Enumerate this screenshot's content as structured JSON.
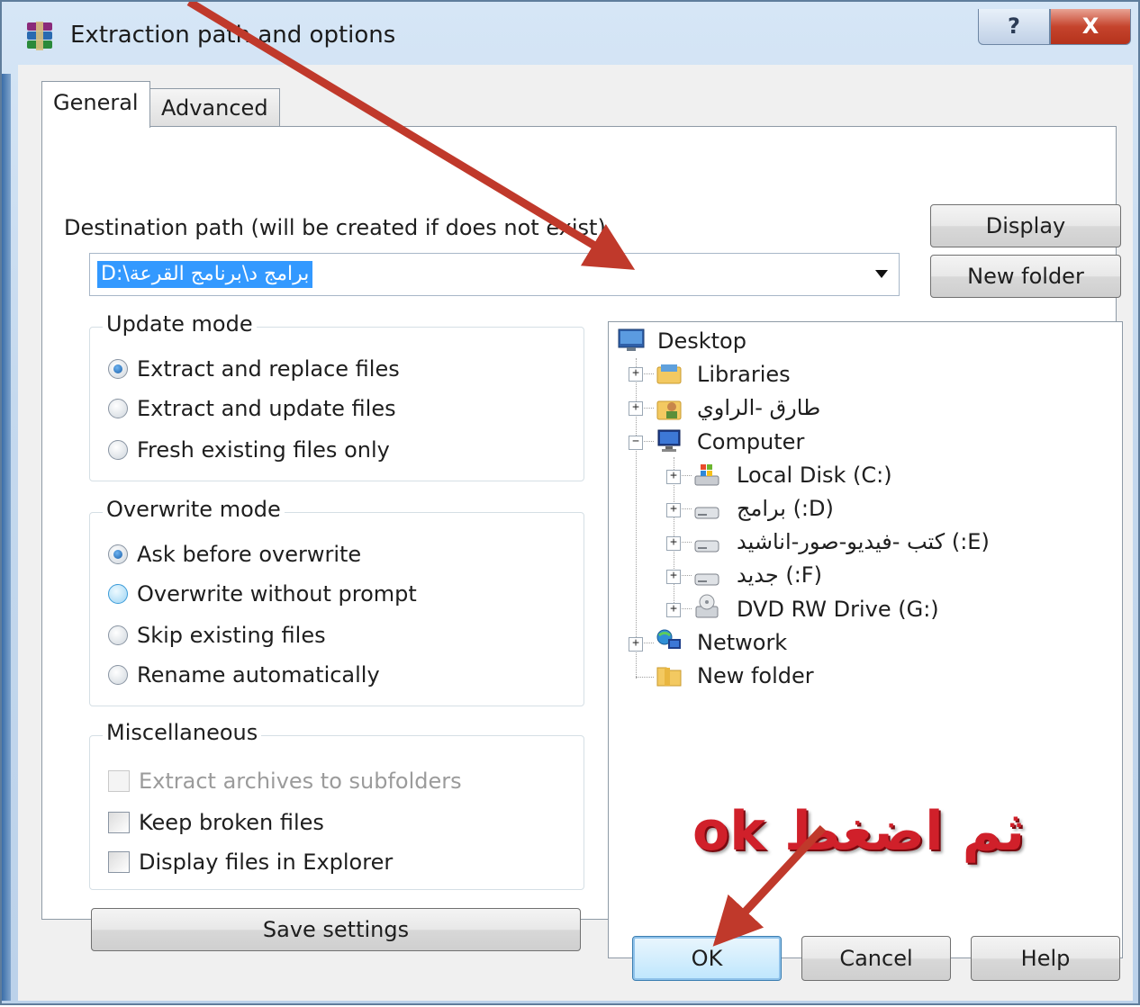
{
  "window": {
    "title": "Extraction path and options",
    "help_glyph": "?",
    "close_glyph": "X"
  },
  "tabs": [
    {
      "label": "General",
      "active": true
    },
    {
      "label": "Advanced",
      "active": false
    }
  ],
  "destination": {
    "label": "Destination path (will be created if does not exist)",
    "value": "D:\\برامج د\\برنامج القرعة"
  },
  "buttons": {
    "display": "Display",
    "new_folder": "New folder",
    "save_settings": "Save settings",
    "ok": "OK",
    "cancel": "Cancel",
    "help": "Help"
  },
  "update_mode": {
    "title": "Update mode",
    "options": [
      {
        "label": "Extract and replace files",
        "selected": true
      },
      {
        "label": "Extract and update files",
        "selected": false
      },
      {
        "label": "Fresh existing files only",
        "selected": false
      }
    ]
  },
  "overwrite_mode": {
    "title": "Overwrite mode",
    "options": [
      {
        "label": "Ask before overwrite",
        "selected": true
      },
      {
        "label": "Overwrite without prompt",
        "selected": false
      },
      {
        "label": "Skip existing files",
        "selected": false
      },
      {
        "label": "Rename automatically",
        "selected": false
      }
    ]
  },
  "miscellaneous": {
    "title": "Miscellaneous",
    "options": [
      {
        "label": "Extract archives to subfolders",
        "checked": false,
        "enabled": false
      },
      {
        "label": "Keep broken files",
        "checked": false,
        "enabled": true
      },
      {
        "label": "Display files in Explorer",
        "checked": false,
        "enabled": true
      }
    ]
  },
  "tree": {
    "nodes": [
      {
        "label": "Desktop",
        "icon": "desktop-icon"
      },
      {
        "label": "Libraries",
        "icon": "libraries-icon"
      },
      {
        "label": "طارق -الراوي",
        "icon": "user-folder-icon"
      },
      {
        "label": "Computer",
        "icon": "computer-icon"
      },
      {
        "label": "Local Disk (C:)",
        "icon": "system-drive-icon"
      },
      {
        "label": "(D:) برامج",
        "icon": "drive-icon"
      },
      {
        "label": "(E:) كتب -فيديو-صور-اناشيد",
        "icon": "drive-icon"
      },
      {
        "label": "(F:) جديد",
        "icon": "drive-icon"
      },
      {
        "label": "DVD RW Drive (G:)",
        "icon": "dvd-drive-icon"
      },
      {
        "label": "Network",
        "icon": "network-icon"
      },
      {
        "label": "New folder",
        "icon": "folder-icon"
      }
    ]
  },
  "annotation": {
    "arabic": "ثم اضغط",
    "ok": "ok",
    "color": "#d0202a",
    "arrow_color": "#c0392b"
  }
}
